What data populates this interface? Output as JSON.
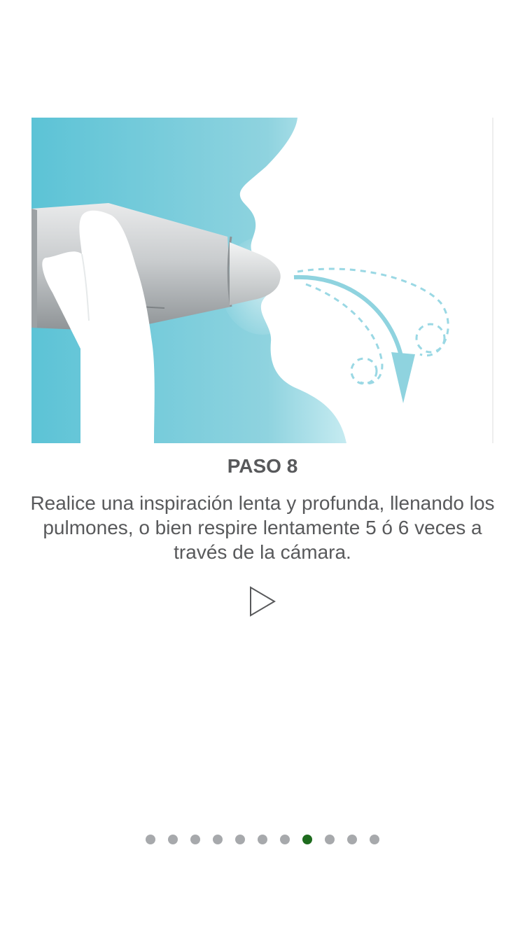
{
  "step": {
    "title": "PASO 8",
    "description": "Realice una inspiración lenta y profunda, llenando los pulmones, o bien respire lentamente 5 ó 6 veces a través de la cámara."
  },
  "illustration": {
    "subject": "person inhaling through inhaler chamber",
    "bg_color": "#8fd3df",
    "accent_color": "#9ad8e4"
  },
  "controls": {
    "play_icon": "play-icon"
  },
  "pager": {
    "total": 11,
    "active_index": 7,
    "active_color": "#1e6b1e",
    "inactive_color": "#a7a9ac"
  }
}
